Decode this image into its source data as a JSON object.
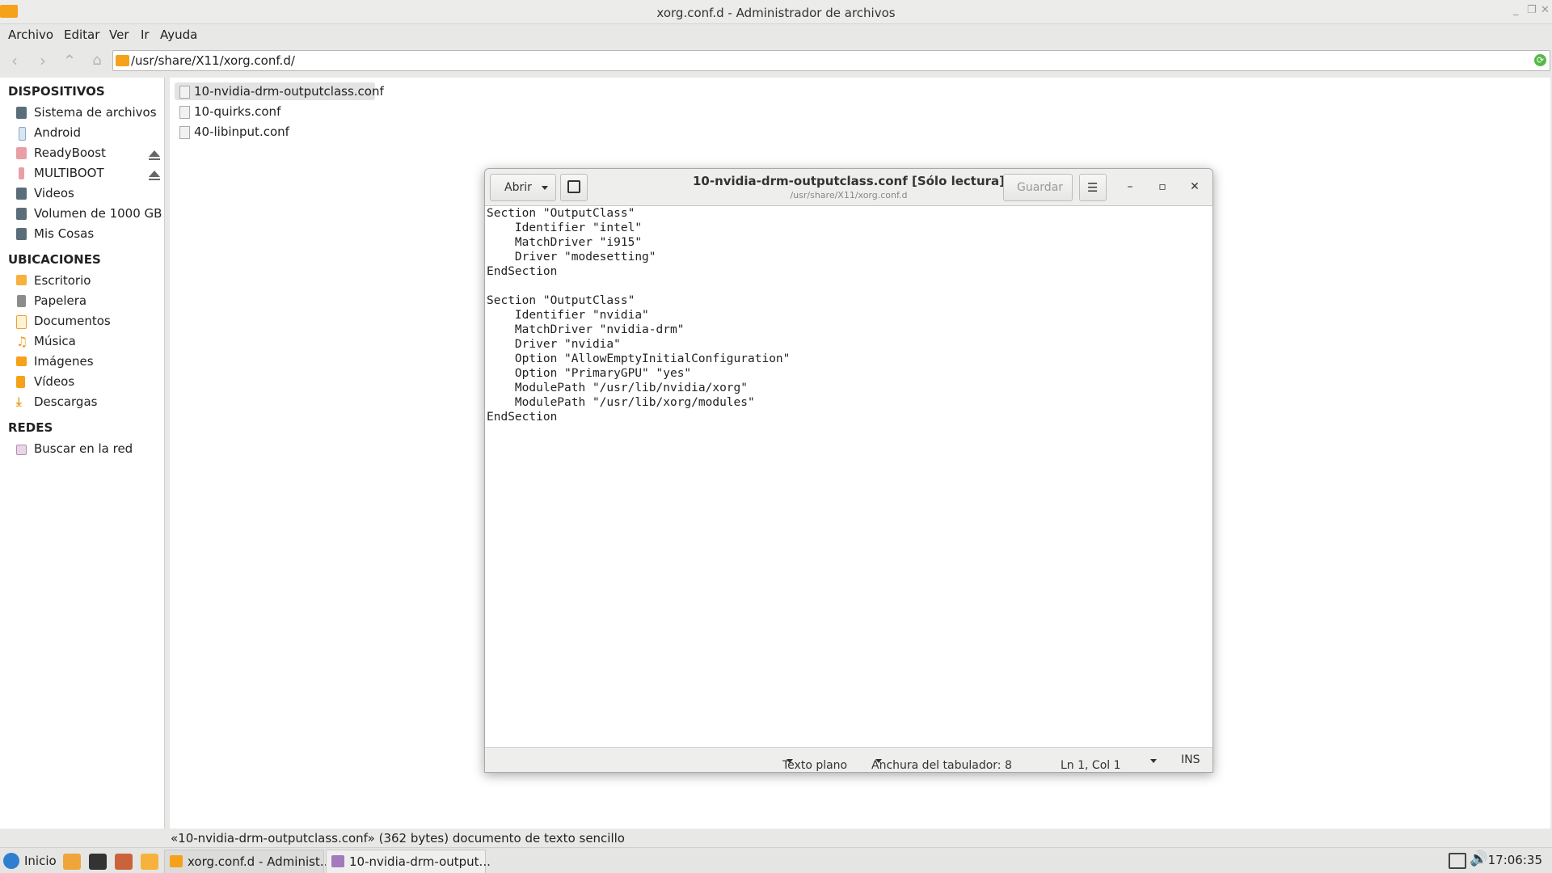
{
  "window": {
    "title": "xorg.conf.d - Administrador de archivos"
  },
  "menubar": {
    "items": [
      "Archivo",
      "Editar",
      "Ver",
      "Ir",
      "Ayuda"
    ]
  },
  "location": {
    "path": "/usr/share/X11/xorg.conf.d/"
  },
  "sidebar": {
    "devices_heading": "DISPOSITIVOS",
    "devices": [
      {
        "label": "Sistema de archivos",
        "icon": "drive-icon"
      },
      {
        "label": "Android",
        "icon": "phone-icon"
      },
      {
        "label": "ReadyBoost",
        "icon": "usb-icon"
      },
      {
        "label": "MULTIBOOT",
        "icon": "usb-icon"
      },
      {
        "label": "Videos",
        "icon": "drive-icon"
      },
      {
        "label": "Volumen de 1000 GB",
        "icon": "drive-icon"
      },
      {
        "label": "Mis Cosas",
        "icon": "drive-icon"
      }
    ],
    "places_heading": "UBICACIONES",
    "places": [
      {
        "label": "Escritorio",
        "icon": "desktop-icon"
      },
      {
        "label": "Papelera",
        "icon": "trash-icon"
      },
      {
        "label": "Documentos",
        "icon": "documents-icon"
      },
      {
        "label": "Música",
        "icon": "music-icon"
      },
      {
        "label": "Imágenes",
        "icon": "images-icon"
      },
      {
        "label": "Vídeos",
        "icon": "videos-icon"
      },
      {
        "label": "Descargas",
        "icon": "downloads-icon"
      }
    ],
    "network_heading": "REDES",
    "network": [
      {
        "label": "Buscar en la red",
        "icon": "network-icon"
      }
    ]
  },
  "files": [
    {
      "name": "10-nvidia-drm-outputclass.conf",
      "selected": true
    },
    {
      "name": "10-quirks.conf",
      "selected": false
    },
    {
      "name": "40-libinput.conf",
      "selected": false
    }
  ],
  "statusbar": {
    "text": "«10-nvidia-drm-outputclass.conf» (362 bytes) documento de texto sencillo"
  },
  "editor": {
    "open_label": "Abrir",
    "title": "10-nvidia-drm-outputclass.conf [Sólo lectura]",
    "subtitle": "/usr/share/X11/xorg.conf.d",
    "save_label": "Guardar",
    "content": "Section \"OutputClass\"\n    Identifier \"intel\"\n    MatchDriver \"i915\"\n    Driver \"modesetting\"\nEndSection\n\nSection \"OutputClass\"\n    Identifier \"nvidia\"\n    MatchDriver \"nvidia-drm\"\n    Driver \"nvidia\"\n    Option \"AllowEmptyInitialConfiguration\"\n    Option \"PrimaryGPU\" \"yes\"\n    ModulePath \"/usr/lib/nvidia/xorg\"\n    ModulePath \"/usr/lib/xorg/modules\"\nEndSection",
    "status": {
      "language": "Texto plano",
      "tab_width": "Anchura del tabulador: 8",
      "position": "Ln 1, Col 1",
      "mode": "INS"
    }
  },
  "taskbar": {
    "start_label": "Inicio",
    "tasks": [
      {
        "label": "xorg.conf.d - Administ...",
        "active": true
      },
      {
        "label": "10-nvidia-drm-output...",
        "active": false
      }
    ],
    "clock": "17:06:35"
  }
}
